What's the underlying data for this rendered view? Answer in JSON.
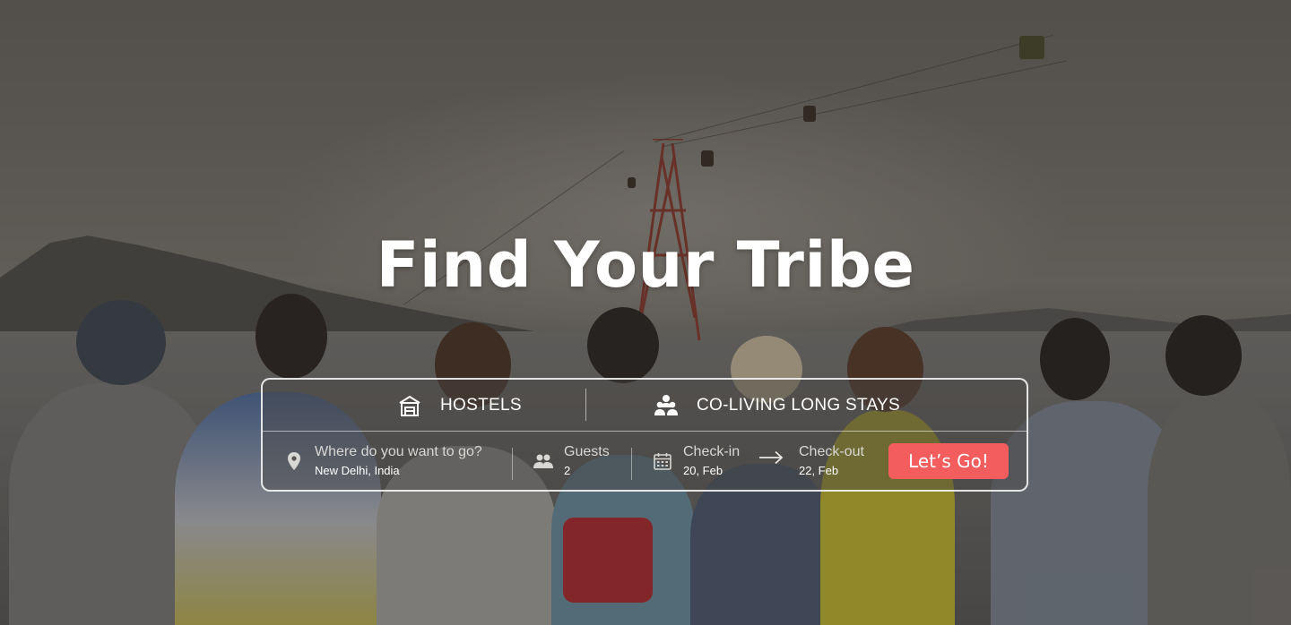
{
  "hero": {
    "title": "Find Your Tribe"
  },
  "search": {
    "tabs": [
      {
        "label": "HOSTELS",
        "icon": "hostel-building-icon"
      },
      {
        "label": "CO-LIVING LONG STAYS",
        "icon": "group-people-icon"
      }
    ],
    "destination": {
      "label": "Where do you want to go?",
      "value": "New Delhi, India",
      "icon": "location-pin-icon"
    },
    "guests": {
      "label": "Guests",
      "value": "2",
      "icon": "guests-icon"
    },
    "check_in": {
      "label": "Check-in",
      "value": "20, Feb",
      "icon": "calendar-icon"
    },
    "check_out": {
      "label": "Check-out",
      "value": "22, Feb"
    },
    "submit_label": "Let’s Go!"
  },
  "colors": {
    "accent": "#f35d5d",
    "text": "#ffffff"
  }
}
